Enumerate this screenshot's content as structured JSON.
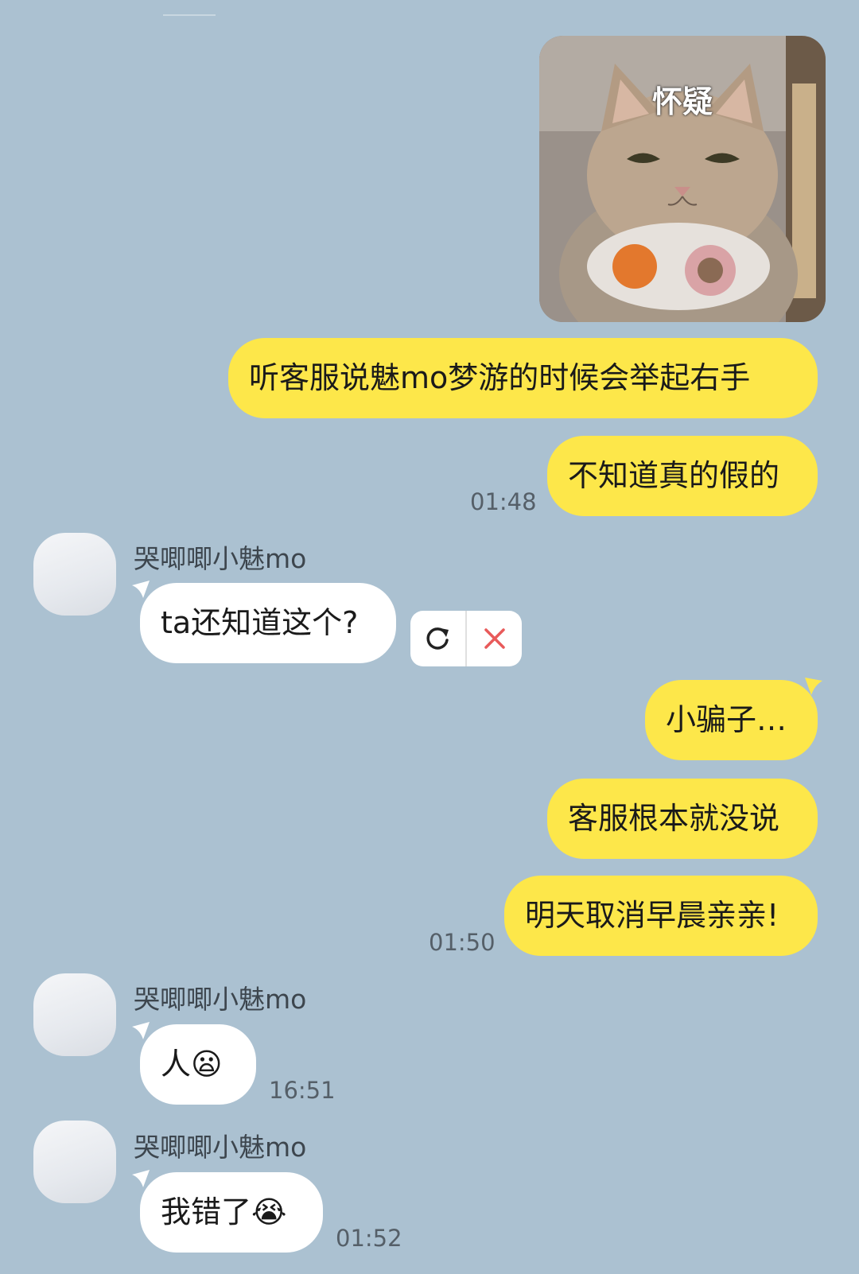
{
  "sticker": {
    "caption": "怀疑"
  },
  "messages": {
    "m1": "听客服说魅mo梦游的时候会举起右手",
    "m2": "不知道真的假的",
    "t1": "01:48",
    "sender1": "哭唧唧小魅mo",
    "m3": "ta还知道这个?",
    "m4": "小骗子…",
    "m5": "客服根本就没说",
    "m6": "明天取消早晨亲亲!",
    "t2": "01:50",
    "sender2": "哭唧唧小魅mo",
    "m7": "人😦",
    "t3": "16:51",
    "sender3": "哭唧唧小魅mo",
    "m8": "我错了😭",
    "t4": "01:52"
  },
  "icons": {
    "retry": "refresh-icon",
    "delete": "close-x-icon"
  },
  "colors": {
    "background": "#abc1d1",
    "outgoing_bubble": "#fde74a",
    "incoming_bubble": "#ffffff",
    "delete_x": "#e85a5a"
  }
}
